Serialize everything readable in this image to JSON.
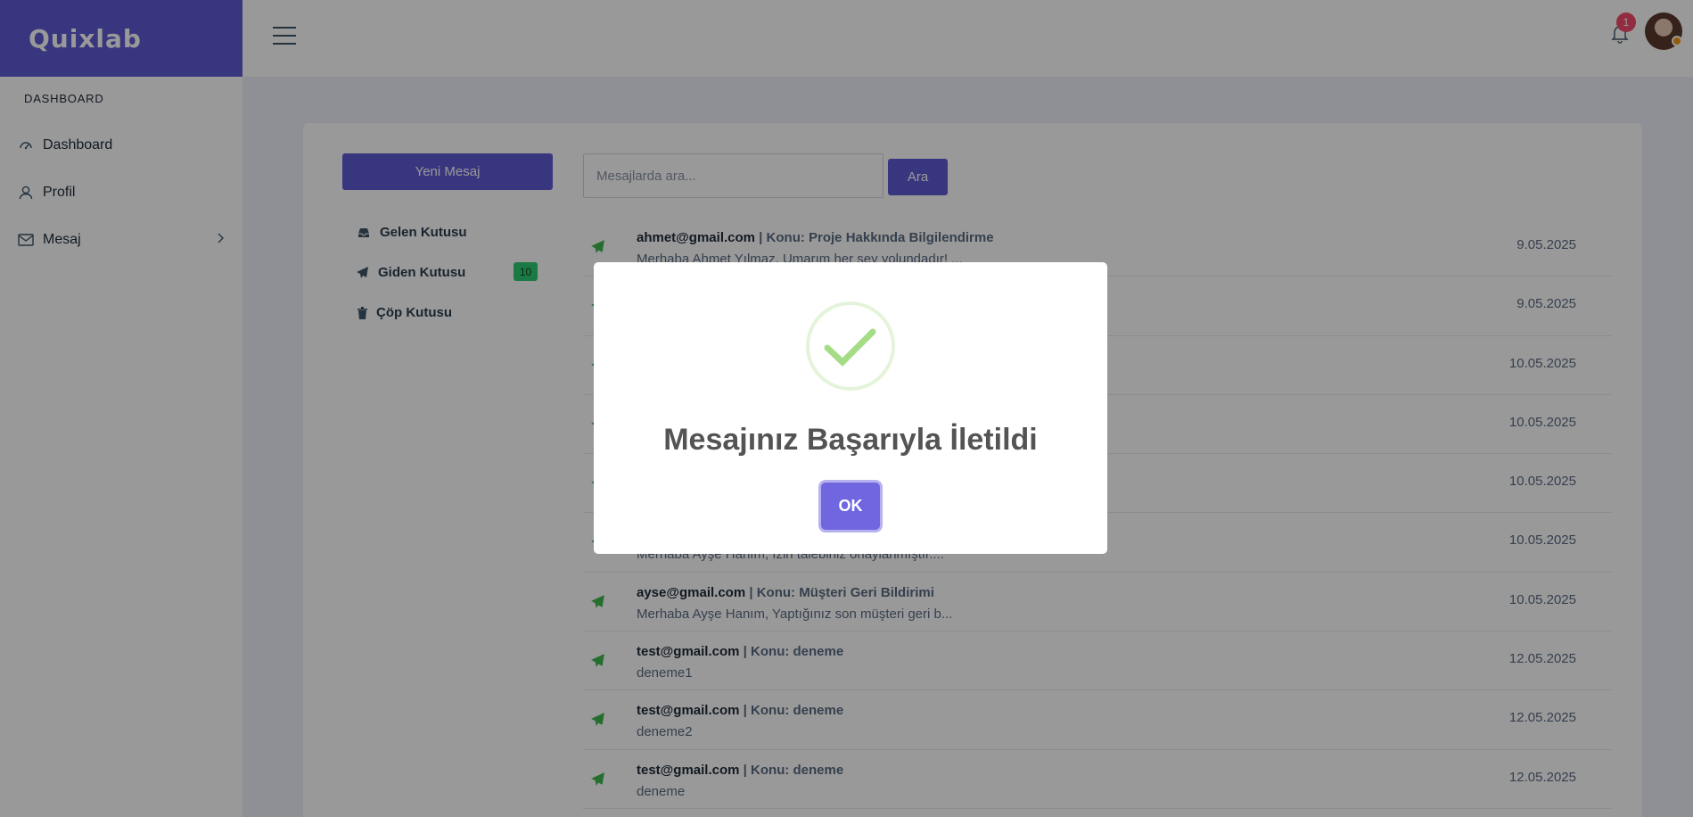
{
  "brand": {
    "name": "Quixlab"
  },
  "sidebar": {
    "section": "DASHBOARD",
    "items": [
      {
        "label": "Dashboard",
        "icon": "speedometer-icon"
      },
      {
        "label": "Profil",
        "icon": "user-icon"
      },
      {
        "label": "Mesaj",
        "icon": "envelope-icon"
      }
    ]
  },
  "header": {
    "notification_count": "1"
  },
  "mail": {
    "new_message_label": "Yeni Mesaj",
    "folders": [
      {
        "label": "Gelen Kutusu",
        "icon": "inbox-icon"
      },
      {
        "label": "Giden Kutusu",
        "icon": "paper-plane-icon",
        "count": "10"
      },
      {
        "label": "Çöp Kutusu",
        "icon": "trash-icon"
      }
    ],
    "search": {
      "placeholder": "Mesajlarda ara...",
      "button_label": "Ara"
    },
    "messages": [
      {
        "email": "ahmet@gmail.com",
        "subject": " | Konu: Proje Hakkında Bilgilendirme",
        "preview": "Merhaba Ahmet Yılmaz, Umarım her şey yolundadır! ...",
        "date": "9.05.2025"
      },
      {
        "email": "",
        "subject": "",
        "preview": "",
        "date": "9.05.2025"
      },
      {
        "email": "",
        "subject": "",
        "preview": "",
        "date": "10.05.2025"
      },
      {
        "email": "",
        "subject": "",
        "preview": "",
        "date": "10.05.2025"
      },
      {
        "email": "",
        "subject": "",
        "preview": "",
        "date": "10.05.2025"
      },
      {
        "email": "",
        "subject": "",
        "preview": "Merhaba Ayşe Hanım, İzin talebiniz onaylanmıştır....",
        "date": "10.05.2025"
      },
      {
        "email": "ayse@gmail.com",
        "subject": " | Konu: Müşteri Geri Bildirimi",
        "preview": "Merhaba Ayşe Hanım, Yaptığınız son müşteri geri b...",
        "date": "10.05.2025"
      },
      {
        "email": "test@gmail.com",
        "subject": " | Konu: deneme",
        "preview": "deneme1",
        "date": "12.05.2025"
      },
      {
        "email": "test@gmail.com",
        "subject": " | Konu: deneme",
        "preview": "deneme2",
        "date": "12.05.2025"
      },
      {
        "email": "test@gmail.com",
        "subject": " | Konu: deneme",
        "preview": "deneme",
        "date": "12.05.2025"
      }
    ]
  },
  "modal": {
    "icon": "success-check-icon",
    "title": "Mesajınız Başarıyla İletildi",
    "ok_label": "OK"
  },
  "colors": {
    "primary": "#5f5bd6",
    "success": "#2ecc71",
    "modal_button": "#7066e0",
    "check": "#a5dc86"
  }
}
